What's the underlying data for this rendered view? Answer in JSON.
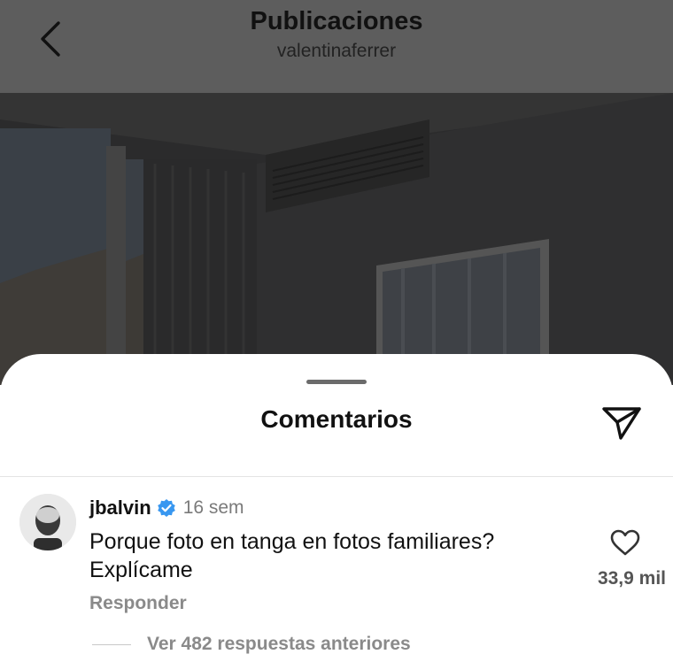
{
  "header": {
    "title": "Publicaciones",
    "subtitle": "valentinaferrer",
    "back_icon": "chevron-left-icon"
  },
  "sheet": {
    "title": "Comentarios",
    "share_icon": "paper-plane-icon"
  },
  "comment": {
    "username": "jbalvin",
    "verified": true,
    "time": "16 sem",
    "text_line1": "Porque foto en tanga en fotos familiares?",
    "text_line2": "Explícame",
    "likes": "33,9 mil",
    "reply_label": "Responder",
    "view_replies_label": "Ver 482 respuestas anteriores"
  },
  "colors": {
    "header_bg": "#5d5d5d",
    "verified_blue": "#3897f0",
    "muted_text": "#8a8a8a"
  }
}
